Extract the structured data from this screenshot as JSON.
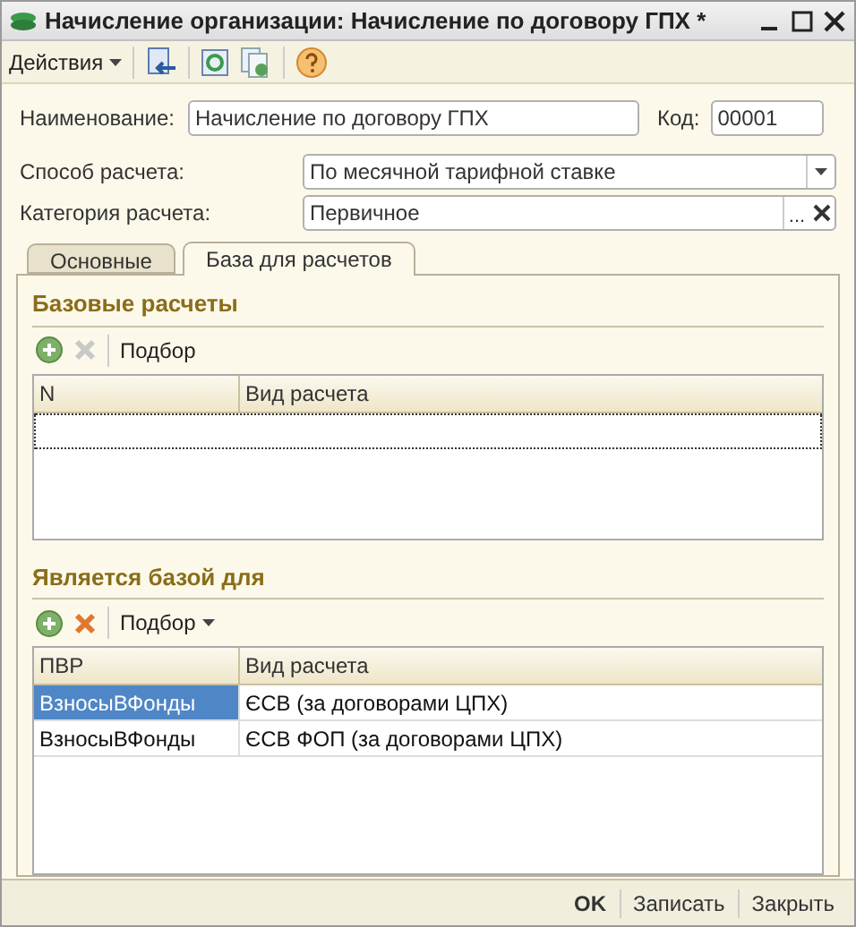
{
  "window": {
    "title": "Начисление организации: Начисление по договору ГПХ *"
  },
  "toolbar": {
    "actions_label": "Действия"
  },
  "fields": [
    {
      "kind": "text",
      "label": "Наименование:",
      "value": "Начисление по договору ГПХ"
    },
    {
      "kind": "code",
      "label": "Код:",
      "value": "00001"
    },
    {
      "kind": "select",
      "label": "Способ расчета:",
      "value": "По месячной тарифной ставке"
    },
    {
      "kind": "reference",
      "label": "Категория расчета:",
      "value": "Первичное",
      "button": "..."
    }
  ],
  "tabs": [
    {
      "label": "Основные",
      "selected": false
    },
    {
      "label": "База для расчетов",
      "selected": true
    }
  ],
  "base_section": {
    "title": "Базовые расчеты",
    "pick_label": "Подбор",
    "delete_disabled": true,
    "pick_menu": false,
    "columns": [
      "N",
      "Вид расчета"
    ]
  },
  "target_section": {
    "title": "Является базой для",
    "pick_label": "Подбор",
    "delete_disabled": false,
    "pick_menu": true,
    "columns": [
      "ПВР",
      "Вид расчета"
    ],
    "rows": [
      {
        "cells": [
          "ВзносыВФонды",
          "ЄСВ (за договорами ЦПХ)"
        ],
        "selected": true
      },
      {
        "cells": [
          "ВзносыВФонды",
          "ЄСВ ФОП (за договорами ЦПХ)"
        ],
        "selected": false
      }
    ]
  },
  "footer": {
    "buttons": [
      {
        "label": "OK",
        "bold": true
      },
      {
        "label": "Записать",
        "bold": false
      },
      {
        "label": "Закрыть",
        "bold": false
      }
    ]
  }
}
